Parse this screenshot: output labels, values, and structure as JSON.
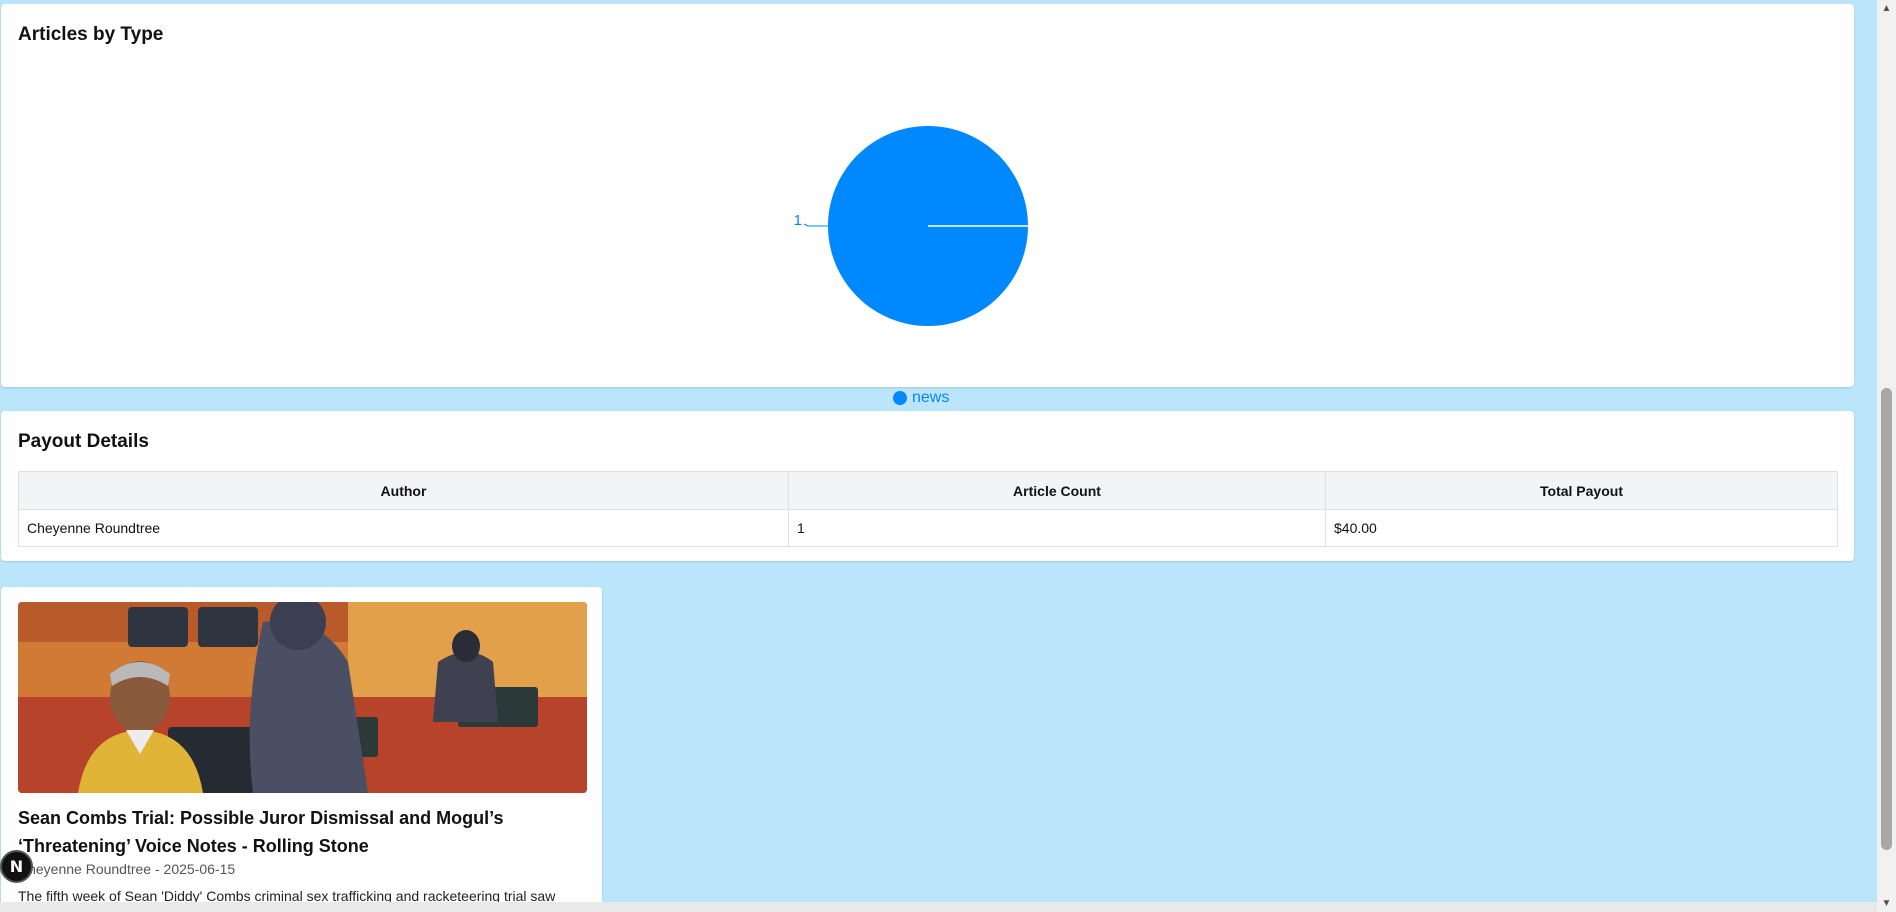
{
  "chart_card": {
    "title": "Articles by Type"
  },
  "chart_data": {
    "type": "pie",
    "title": "Articles by Type",
    "slices": [
      {
        "label": "news",
        "value": 1,
        "color": "#0088fe"
      }
    ],
    "data_labels": [
      "1"
    ],
    "legend": {
      "position": "bottom",
      "entries": [
        "news"
      ]
    }
  },
  "payout": {
    "title": "Payout Details",
    "columns": [
      "Author",
      "Article Count",
      "Total Payout"
    ],
    "rows": [
      {
        "author": "Cheyenne Roundtree",
        "count": "1",
        "payout": "$40.00"
      }
    ]
  },
  "article": {
    "title": "Sean Combs Trial: Possible Juror Dismissal and Mogul’s ‘Threatening’ Voice Notes - Rolling Stone",
    "meta": "Cheyenne Roundtree - 2025-06-15",
    "excerpt": "The fifth week of Sean 'Diddy' Combs criminal sex trafficking and racketeering trial saw",
    "image_alt": "courtroom-sketch"
  },
  "badge": {
    "label": "N"
  },
  "scrollbar": {
    "up_icon": "▲",
    "down_icon": "▼"
  }
}
